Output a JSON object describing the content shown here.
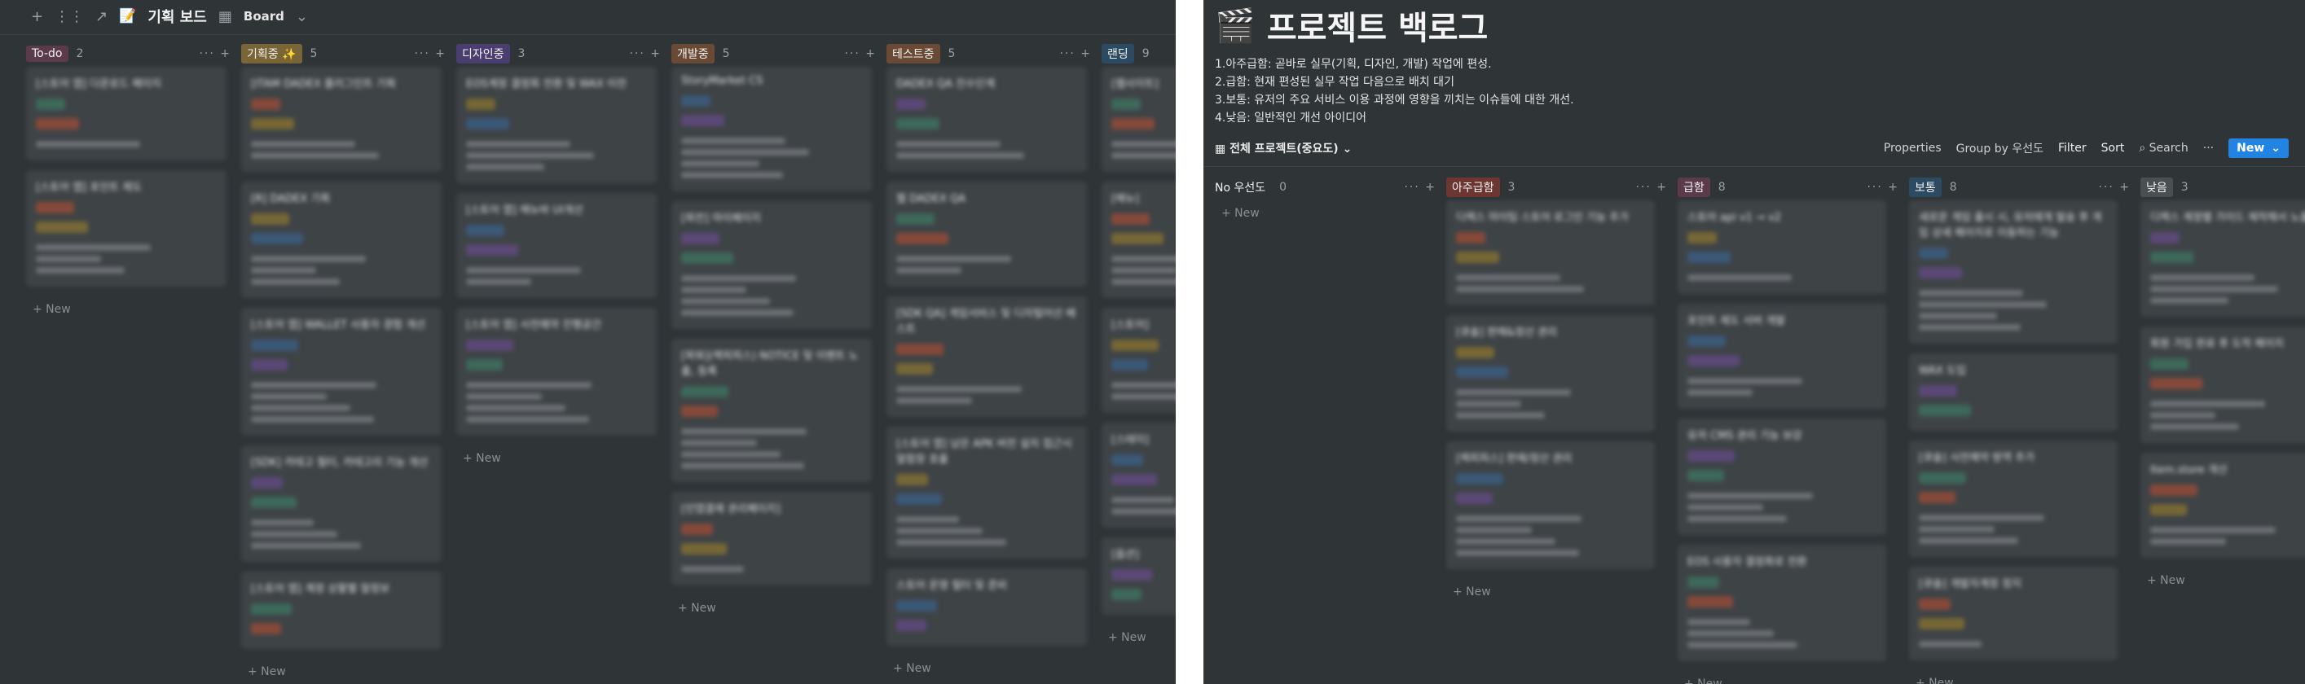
{
  "left": {
    "title": "기획 보드",
    "view": "Board",
    "columns": [
      {
        "label": "To-do",
        "count": "2",
        "color": "#5b3a4c",
        "cards": [
          {
            "title": "[스토어 앱] 다운로드 페이지",
            "rows": 3
          },
          {
            "title": "[스토어 앱] 포인트 제도",
            "rows": 5
          }
        ]
      },
      {
        "label": "기획중 ✨",
        "count": "5",
        "color": "#7a6536",
        "cards": [
          {
            "title": "[ITAM DADEX 플러그인트 기획",
            "rows": 4
          },
          {
            "title": "[R] DADEX 기획",
            "rows": 5
          },
          {
            "title": "[스토어 앱] WALLET 사용자 경험 개선",
            "rows": 6
          },
          {
            "title": "[SDK] 카테고 필터, 카테고리 기능 개선",
            "rows": 5
          },
          {
            "title": "[스토어 앱] 계정 상황별 말정보",
            "rows": 2
          }
        ]
      },
      {
        "label": "디자인중",
        "count": "3",
        "color": "#4a3d70",
        "cards": [
          {
            "title": "EOS계정 결정회 전환 및 WAX 이전",
            "rows": 5
          },
          {
            "title": "[스토어 앱] 메뉴바 UI개선",
            "rows": 4
          },
          {
            "title": "[스토어 앱] 사전예약 진행공간",
            "rows": 6
          }
        ]
      },
      {
        "label": "개발중",
        "count": "5",
        "color": "#6a4a34",
        "cards": [
          {
            "title": "StoryMarket CS",
            "rows": 6
          },
          {
            "title": "[파컨] 마이페이지",
            "rows": 6
          },
          {
            "title": "[파워](랙피피스) NOTICE 및 이벤트 노출, 등록",
            "rows": 6
          },
          {
            "title": "[인앱결제 관리페이지]",
            "rows": 3
          }
        ]
      },
      {
        "label": "테스트중",
        "count": "5",
        "color": "#6a4a34",
        "cards": [
          {
            "title": "DADEX QA 진수단계",
            "rows": 4
          },
          {
            "title": "웹 DADEX QA",
            "rows": 4
          },
          {
            "title": "[SDK QA] 게임서비스 및 디자털어선 배스트",
            "rows": 4
          },
          {
            "title": "[스토어 앱] 남은 APK 버전 설치 접근시 알람창 호출",
            "rows": 5
          },
          {
            "title": "스토어 운영 필터 및 준비",
            "rows": 2
          }
        ]
      },
      {
        "label": "랜딩",
        "count": "9",
        "color": "#2d4a63",
        "cards": [
          {
            "title": "[웹사이트]",
            "rows": 4
          },
          {
            "title": "[메뉴]",
            "rows": 5
          },
          {
            "title": "[스토어]",
            "rows": 4
          },
          {
            "title": "[스테이]",
            "rows": 4
          },
          {
            "title": "[옵션]",
            "rows": 2
          }
        ]
      }
    ],
    "new_label": "New"
  },
  "right": {
    "title": "프로젝트 백로그",
    "notes": [
      "1.아주급함: 곧바로 실무(기획, 디자인, 개발) 작업에 편성.",
      "2.급함: 현재 편성된 실무 작업 다음으로 배치 대기",
      "3.보통: 유저의 주요 서비스 이용 과정에 영향을 끼치는 이슈들에 대한 개선.",
      "4.낮음: 일반적인 개선 아이디어"
    ],
    "view": "전체 프로젝트(중요도)",
    "toolbar": {
      "properties": "Properties",
      "group": "Group by 우선도",
      "filter": "Filter",
      "sort": "Sort",
      "search": "Search",
      "more": "···",
      "new": "New"
    },
    "columns": [
      {
        "label": "No 우선도",
        "count": "0",
        "color": "",
        "cards": []
      },
      {
        "label": "아주급함",
        "count": "3",
        "color": "#6e3630",
        "cards": [
          {
            "title": "디렉스 마이팀 스토어 로그인 기능 추가",
            "rows": 4
          },
          {
            "title": "[큐솔] 판매&정산 관리",
            "rows": 5
          },
          {
            "title": "[렉피피스] 판매/정산 관리",
            "rows": 6
          }
        ]
      },
      {
        "label": "급함",
        "count": "8",
        "color": "#5b3a4c",
        "cards": [
          {
            "title": "스토어 api v1 → v2",
            "rows": 3
          },
          {
            "title": "포인트 제도 서버 개발",
            "rows": 4
          },
          {
            "title": "유저 CMS 관리 기능 보강",
            "rows": 5
          },
          {
            "title": "EOS 사용자 결정화로 전환",
            "rows": 5
          }
        ]
      },
      {
        "label": "보통",
        "count": "8",
        "color": "#2d4a63",
        "cards": [
          {
            "title": "새로운 게임 출시 시, 유저에게 발송 후 게임 상세 페이지로 이동하는 기능",
            "rows": 6
          },
          {
            "title": "WAX 도입",
            "rows": 2
          },
          {
            "title": "[큐솔] 사전예약 방역 추가",
            "rows": 5
          },
          {
            "title": "[큐솔] 개발자계정 정지",
            "rows": 3
          }
        ]
      },
      {
        "label": "낮음",
        "count": "3",
        "color": "#4a4f52",
        "cards": [
          {
            "title": "디렉스 계정별 가이드 제작해서 노출하기",
            "rows": 5
          },
          {
            "title": "회원 가입 완료 후 도착 페이지",
            "rows": 5
          },
          {
            "title": "Item.store 개선",
            "rows": 4
          }
        ]
      }
    ],
    "new_label": "New"
  }
}
